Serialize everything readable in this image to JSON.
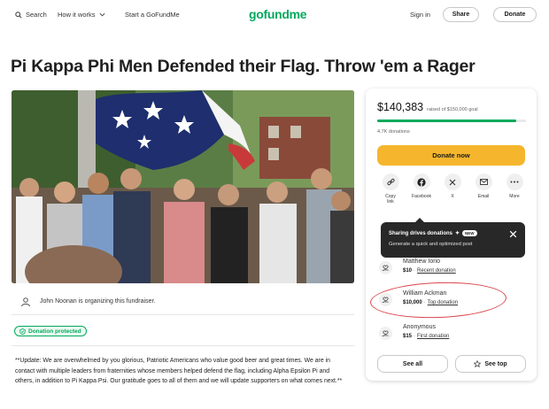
{
  "header": {
    "search_label": "Search",
    "how_it_works_label": "How it works",
    "start_label": "Start a GoFundMe",
    "logo_text": "gofundme",
    "signin_label": "Sign in",
    "share_label": "Share",
    "donate_label": "Donate"
  },
  "page": {
    "title": "Pi Kappa Phi Men Defended their Flag. Throw 'em a Rager"
  },
  "organizer": {
    "text": "John Noonan is organizing this fundraiser."
  },
  "badge": {
    "label": "Donation protected"
  },
  "story": {
    "text": "**Update: We are overwhelmed by you glorious, Patriotic Americans who value good beer and great times. We are in contact with multiple leaders from fraternities whose members helped defend the flag, including Alpha Epsilon Pi and others, in addition to Pi Kappa Psi. Our gratitude goes to all of them and we will update supporters on what comes next.**"
  },
  "sidebar": {
    "raised_amount": "$140,383",
    "goal_text": "raised of $150,000 goal",
    "progress_fraction": 0.936,
    "donations_count": "4.7K donations",
    "donate_now_label": "Donate now",
    "share_options": [
      {
        "label": "Copy link",
        "icon": "link-icon"
      },
      {
        "label": "Facebook",
        "icon": "facebook-icon"
      },
      {
        "label": "X",
        "icon": "x-icon"
      },
      {
        "label": "Email",
        "icon": "email-icon"
      },
      {
        "label": "More",
        "icon": "more-icon"
      }
    ],
    "tooltip": {
      "title": "Sharing drives donations",
      "new_badge": "NEW",
      "subtitle": "Generate a quick and optimized post"
    },
    "donors": [
      {
        "name": "Matthew Iorio",
        "amount": "$10",
        "tag": "Recent donation"
      },
      {
        "name": "William Ackman",
        "amount": "$10,000",
        "tag": "Top donation"
      },
      {
        "name": "Anonymous",
        "amount": "$15",
        "tag": "First donation"
      }
    ],
    "see_all_label": "See all",
    "see_top_label": "See top"
  },
  "colors": {
    "brand_green": "#02a95c",
    "donate_yellow": "#f5b62e",
    "highlight_red": "#d9464c"
  }
}
